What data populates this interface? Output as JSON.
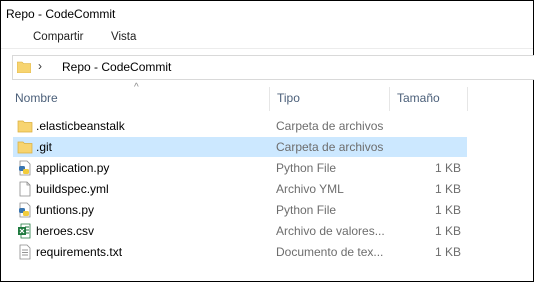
{
  "window": {
    "title": "Repo - CodeCommit"
  },
  "menu": {
    "share_label": "Compartir",
    "view_label": "Vista"
  },
  "address": {
    "path": "Repo - CodeCommit",
    "separator": "›",
    "folder_icon": "folder-icon"
  },
  "columns": {
    "name": "Nombre",
    "type": "Tipo",
    "size": "Tamaño",
    "sort_indicator": "^"
  },
  "files": [
    {
      "name": ".elasticbeanstalk",
      "type": "Carpeta de archivos",
      "size": "",
      "icon": "folder-icon",
      "selected": false
    },
    {
      "name": ".git",
      "type": "Carpeta de archivos",
      "size": "",
      "icon": "folder-icon",
      "selected": true
    },
    {
      "name": "application.py",
      "type": "Python File",
      "size": "1 KB",
      "icon": "python-file-icon",
      "selected": false
    },
    {
      "name": "buildspec.yml",
      "type": "Archivo YML",
      "size": "1 KB",
      "icon": "document-icon",
      "selected": false
    },
    {
      "name": "funtions.py",
      "type": "Python File",
      "size": "1 KB",
      "icon": "python-file-icon",
      "selected": false
    },
    {
      "name": "heroes.csv",
      "type": "Archivo de valores...",
      "size": "1 KB",
      "icon": "excel-csv-icon",
      "selected": false
    },
    {
      "name": "requirements.txt",
      "type": "Documento de tex...",
      "size": "1 KB",
      "icon": "text-file-icon",
      "selected": false
    }
  ],
  "colors": {
    "selection": "#cce8ff",
    "folder": "#f7d470",
    "header_text": "#4c607a"
  }
}
